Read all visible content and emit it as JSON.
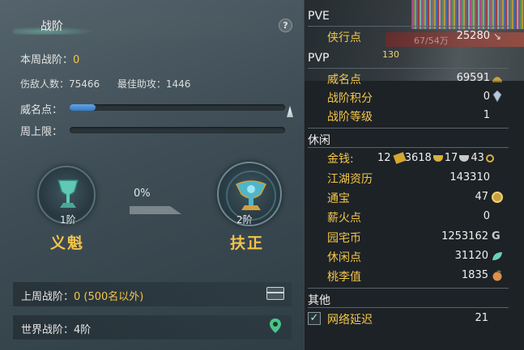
{
  "left": {
    "title": "战阶",
    "help": "?",
    "weekly_rank_label": "本周战阶：",
    "weekly_rank_value": "0",
    "kills_label": "伤敌人数：",
    "kills_value": "75466",
    "assists_label": "最佳助攻：",
    "assists_value": "1446",
    "prestige_label": "威名点：",
    "prestige_progress": 0.12,
    "weekly_cap_label": "周上限：",
    "weekly_cap_progress": 0,
    "progress_percent": "0%",
    "current_rank_num": "1阶",
    "current_rank_name": "义魁",
    "next_rank_num": "2阶",
    "next_rank_name": "扶正",
    "last_week_label": "上周战阶：",
    "last_week_value": "0 (500名以外)",
    "world_rank_text": "世界战阶：4阶"
  },
  "right": {
    "overlay_text": "67/54万",
    "overlay_level": "130",
    "pve_header": "PVE",
    "pve": [
      {
        "label": "侠行点",
        "value": "25280",
        "icon": "arrow-icon"
      }
    ],
    "pvp_header": "PVP",
    "pvp": [
      {
        "label": "威名点",
        "value": "69591",
        "icon": "helmet-icon"
      },
      {
        "label": "战阶积分",
        "value": "0",
        "icon": "crystal-icon"
      },
      {
        "label": "战阶等级",
        "value": "1",
        "icon": ""
      }
    ],
    "leisure_header": "休闲",
    "money": {
      "label": "金钱:",
      "gold": "12",
      "silver": "3618",
      "copper": "17",
      "coin": "43"
    },
    "leisure": [
      {
        "label": "江湖资历",
        "value": "143310",
        "icon": ""
      },
      {
        "label": "通宝",
        "value": "47",
        "icon": "coin-icon"
      },
      {
        "label": "薪火点",
        "value": "0",
        "icon": ""
      },
      {
        "label": "园宅币",
        "value": "1253162",
        "icon": "g-coin-icon"
      },
      {
        "label": "休闲点",
        "value": "31120",
        "icon": "leaf-icon"
      },
      {
        "label": "桃李值",
        "value": "1835",
        "icon": "peach-icon"
      }
    ],
    "other_header": "其他",
    "latency_label": "网络延迟",
    "latency_value": "21",
    "latency_checked": "✓"
  },
  "colors": {
    "accent_gold": "#f3c64a",
    "progress_blue": "#4a8fd8"
  }
}
